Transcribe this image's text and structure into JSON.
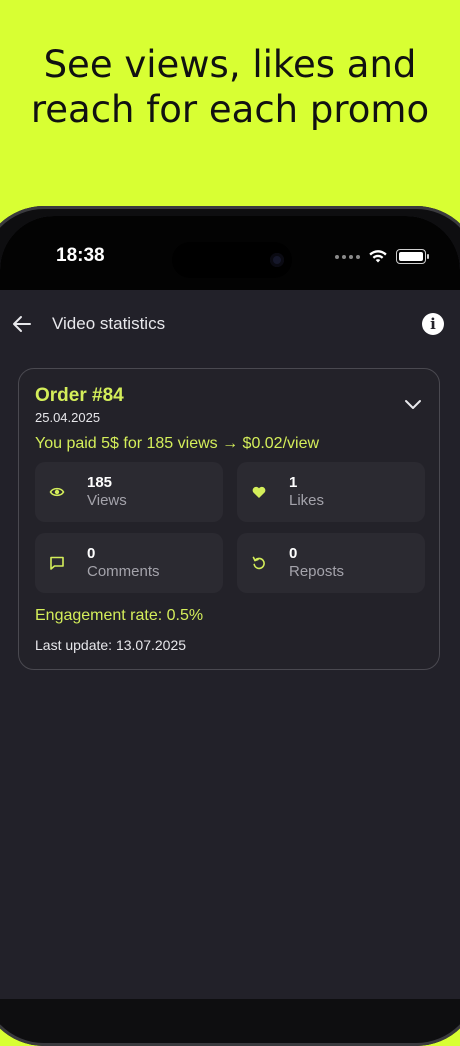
{
  "promo": {
    "headline": "See views, likes and reach for each promo"
  },
  "status_bar": {
    "time": "18:38"
  },
  "header": {
    "title": "Video statistics",
    "info_glyph": "i"
  },
  "order": {
    "title": "Order #84",
    "date": "25.04.2025",
    "paid_summary": "You paid 5$ for 185 views → $0.02/view",
    "stats": [
      {
        "icon": "eye-icon",
        "value": "185",
        "label": "Views"
      },
      {
        "icon": "heart-icon",
        "value": "1",
        "label": "Likes"
      },
      {
        "icon": "comment-icon",
        "value": "0",
        "label": "Comments"
      },
      {
        "icon": "repost-icon",
        "value": "0",
        "label": "Reposts"
      }
    ],
    "engagement": "Engagement rate: 0.5%",
    "last_update": "Last update: 13.07.2025"
  },
  "colors": {
    "accent": "#d4ee5a",
    "promo_background": "#d8ff33",
    "screen_background": "#222129"
  }
}
